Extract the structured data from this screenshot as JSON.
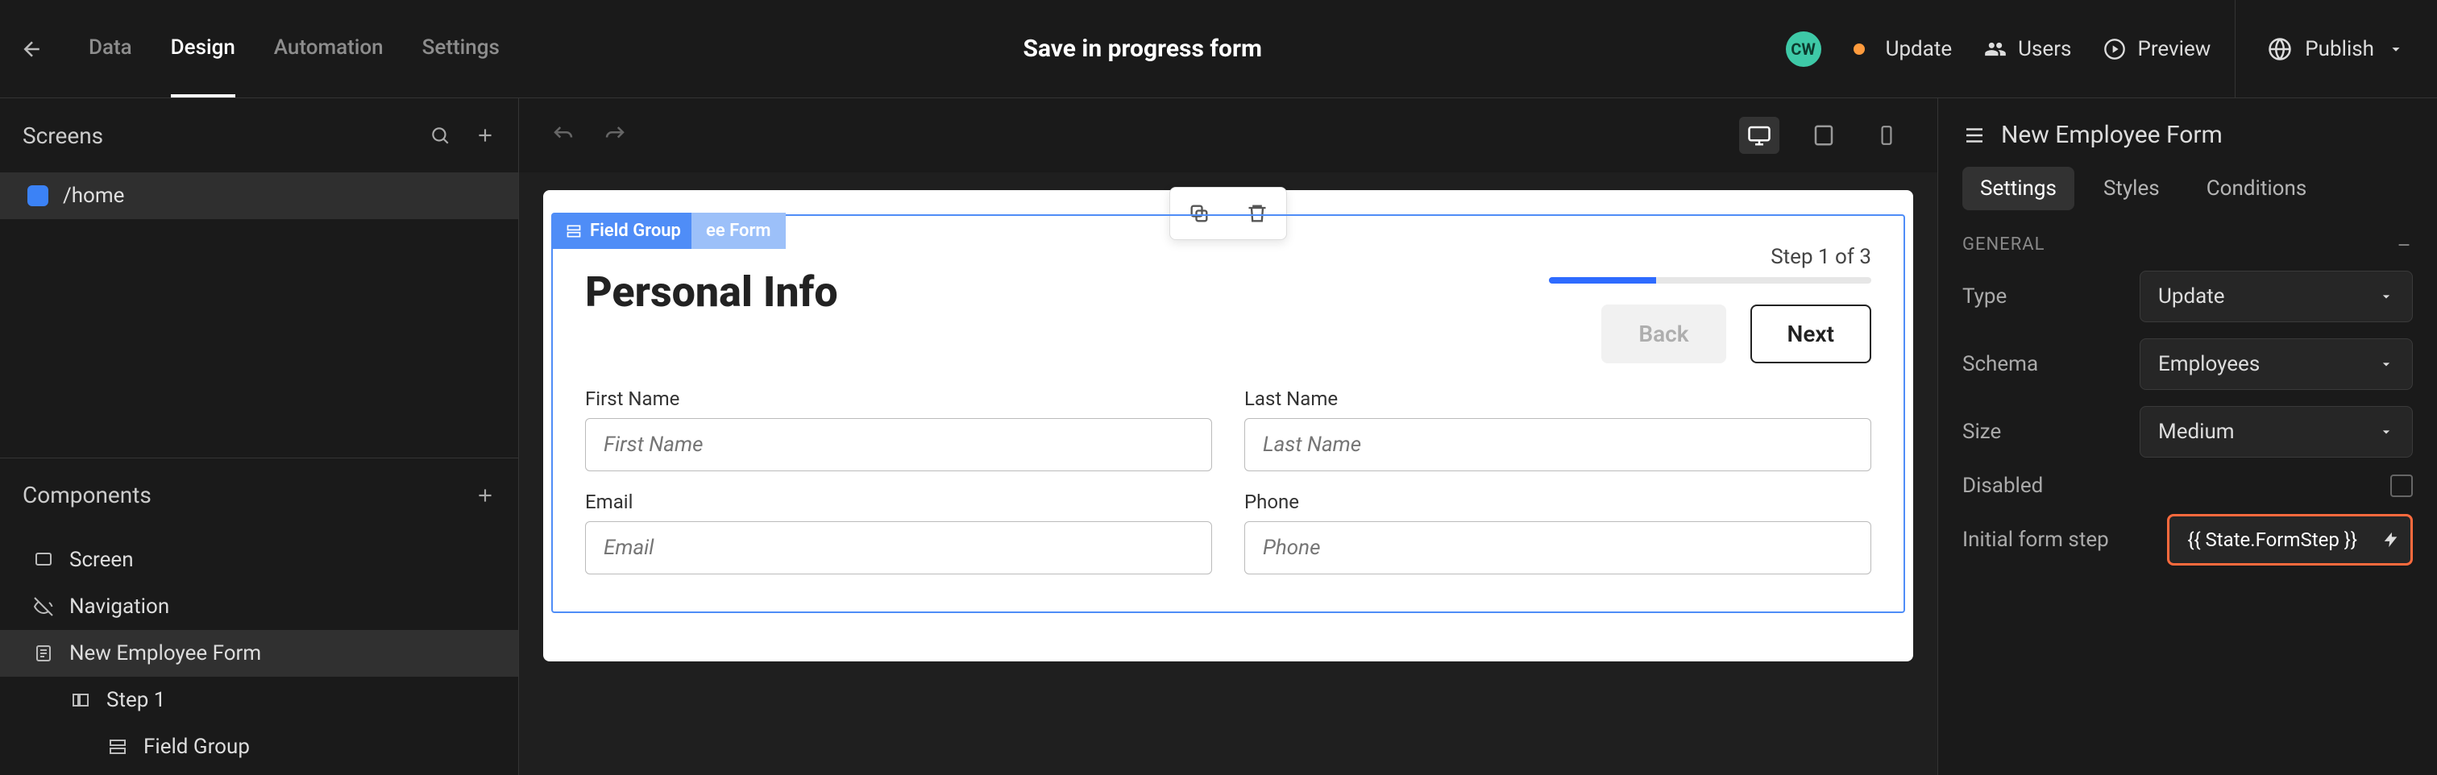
{
  "header": {
    "tabs": {
      "data": "Data",
      "design": "Design",
      "automation": "Automation",
      "settings": "Settings"
    },
    "title": "Save in progress form",
    "avatar": "CW",
    "update": "Update",
    "users": "Users",
    "preview": "Preview",
    "publish": "Publish"
  },
  "left": {
    "screens_label": "Screens",
    "screen_home": "/home",
    "components_label": "Components",
    "tree": {
      "screen": "Screen",
      "navigation": "Navigation",
      "form": "New Employee Form",
      "step1": "Step 1",
      "field_group": "Field Group"
    }
  },
  "canvas": {
    "chip1": "Field Group",
    "chip2": "ee Form",
    "title": "Personal Info",
    "step_text": "Step 1 of 3",
    "back": "Back",
    "next": "Next",
    "fields": {
      "first_name_label": "First Name",
      "first_name_ph": "First Name",
      "last_name_label": "Last Name",
      "last_name_ph": "Last Name",
      "email_label": "Email",
      "email_ph": "Email",
      "phone_label": "Phone",
      "phone_ph": "Phone"
    }
  },
  "right": {
    "title": "New Employee Form",
    "tabs": {
      "settings": "Settings",
      "styles": "Styles",
      "conditions": "Conditions"
    },
    "general": "GENERAL",
    "props": {
      "type_label": "Type",
      "type_value": "Update",
      "schema_label": "Schema",
      "schema_value": "Employees",
      "size_label": "Size",
      "size_value": "Medium",
      "disabled_label": "Disabled",
      "initial_label": "Initial form step",
      "initial_value": "{{ State.FormStep }}"
    }
  }
}
